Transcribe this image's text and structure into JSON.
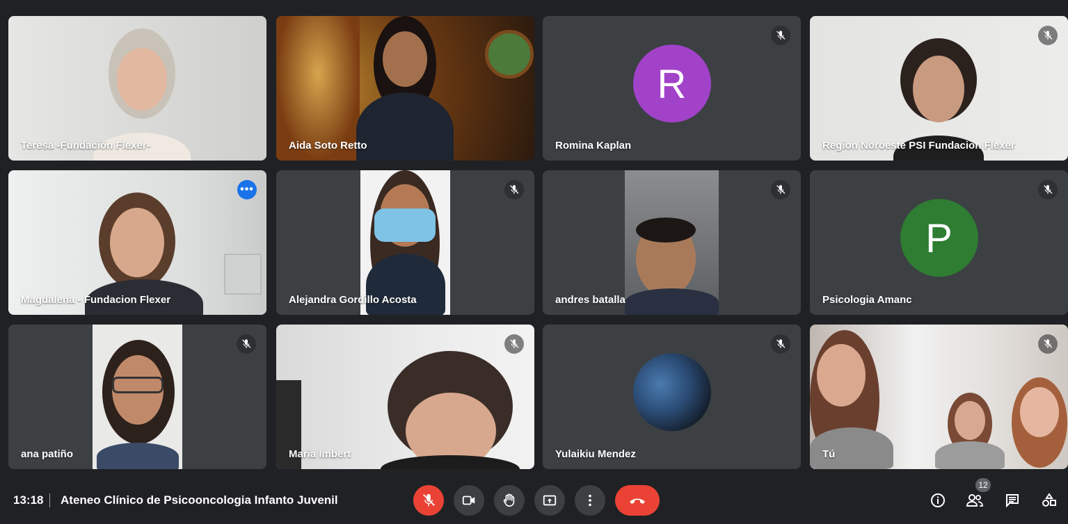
{
  "participants": [
    {
      "name": "Teresa -Fundación Flexer-"
    },
    {
      "name": "Aida Soto Retto"
    },
    {
      "name": "Romina Kaplan",
      "initial": "R",
      "avatar_color": "#a142c9"
    },
    {
      "name": "Region Noroeste PSI Fundacion Flexer"
    },
    {
      "name": "Magdalena - Fundacion Flexer"
    },
    {
      "name": "Alejandra Gordillo Acosta"
    },
    {
      "name": "andres batalla"
    },
    {
      "name": "Psicologia Amanc",
      "initial": "P",
      "avatar_color": "#2e7d32"
    },
    {
      "name": "ana patiño"
    },
    {
      "name": "Maria Imbert"
    },
    {
      "name": "Yulaikiu Mendez"
    },
    {
      "name": "Tú"
    }
  ],
  "bottom_bar": {
    "time": "13:18",
    "meeting_title": "Ateneo Clínico de Psicooncologia Infanto Juvenil",
    "participant_count": "12"
  },
  "colors": {
    "background": "#202124",
    "tile": "#3c4043",
    "accent_blue": "#8ab4f8",
    "red": "#ea4335"
  }
}
